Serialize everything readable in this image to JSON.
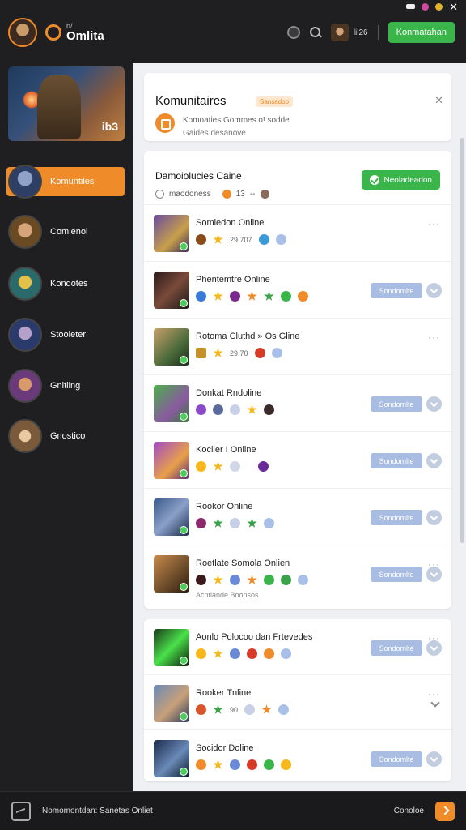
{
  "header": {
    "brand_small": "n/",
    "brand_name": "Omlita",
    "user_name": "lil26",
    "cta_label": "Konmatahan"
  },
  "sidebar": {
    "banner_text": "ib3",
    "items": [
      {
        "label": "Komuntiles",
        "active": true
      },
      {
        "label": "Comienol",
        "active": false
      },
      {
        "label": "Kondotes",
        "active": false
      },
      {
        "label": "Stooleter",
        "active": false
      },
      {
        "label": "Gnitiing",
        "active": false
      },
      {
        "label": "Gnostico",
        "active": false
      }
    ]
  },
  "title_card": {
    "title": "Komunitaires",
    "badge": "Sansadoo",
    "sub1": "Komoaties Gommes o! sodde",
    "sub2": "Gaides desanove"
  },
  "list_head": {
    "title": "Damoiolucies Caine",
    "meta_text": "maodoness",
    "meta_count": "13",
    "meta_dash": "--",
    "button_label": "Neoladeadon"
  },
  "rows": [
    {
      "title": "Somiedon Online",
      "num": "29.707",
      "action": "more"
    },
    {
      "title": "Phentemtre Online",
      "action": "button",
      "button": "Sondomlte"
    },
    {
      "title": "Rotoma Cluthd » Os Gline",
      "num": "29.70",
      "action": "more"
    },
    {
      "title": "Donkat Rndoline",
      "action": "button",
      "button": "Sondomlte"
    },
    {
      "title": "Koclier I Online",
      "action": "button",
      "button": "Sondomlte"
    },
    {
      "title": "Rookor Online",
      "action": "button",
      "button": "Sondomlte"
    },
    {
      "title": "Roetlate Somola Onlien",
      "action": "button",
      "button": "Sondomlte",
      "sub": "Acntiande Boonsos"
    }
  ],
  "rows2": [
    {
      "title": "Aonlo Polocoo dan Frtevedes",
      "action": "button",
      "button": "Sondomlte"
    },
    {
      "title": "Rooker Tnline",
      "num": "90",
      "action": "chevron"
    },
    {
      "title": "Socidor Doline",
      "action": "button",
      "button": "Sondomlte"
    }
  ],
  "footer": {
    "text": "Nomomontdan: Sanetas Onliet",
    "label": "Conoloe"
  },
  "colors": {
    "accent_orange": "#f08b2a",
    "accent_green": "#3ab54a",
    "panel_bg": "#eef0f4",
    "app_bg": "#1f1f21"
  }
}
